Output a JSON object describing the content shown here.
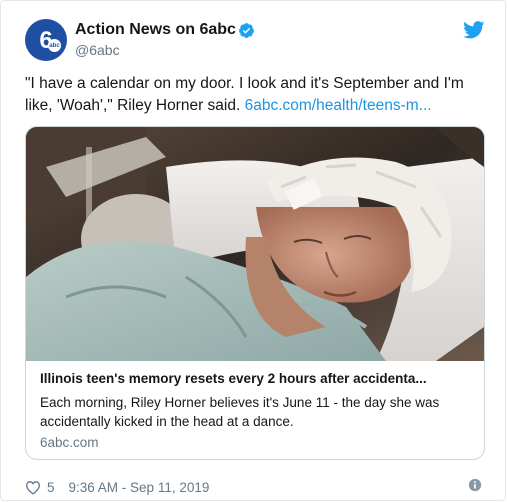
{
  "account": {
    "name": "Action News on 6abc",
    "handle": "@6abc",
    "avatar_text": "6",
    "avatar_badge": "abc"
  },
  "tweet": {
    "text": "\"I have a calendar on my door. I look and it's September and I'm like, 'Woah',\" Riley Horner said. ",
    "link": "6abc.com/health/teens-m..."
  },
  "card": {
    "title": "Illinois teen's memory resets every 2 hours after accidenta...",
    "description": "Each morning, Riley Horner believes it's June 11 - the day she was accidentally kicked in the head at a dance.",
    "domain": "6abc.com"
  },
  "footer": {
    "likes": "5",
    "timestamp": "9:36 AM - Sep 11, 2019"
  },
  "colors": {
    "brand_blue": "#1da1f2",
    "link_blue": "#1b95e0",
    "text": "#14171a",
    "muted": "#657786",
    "avatar_bg": "#1f4fa3"
  },
  "icons": {
    "verified": "verified-badge-icon",
    "logo": "twitter-bird-icon",
    "like": "heart-icon",
    "info": "info-icon"
  }
}
